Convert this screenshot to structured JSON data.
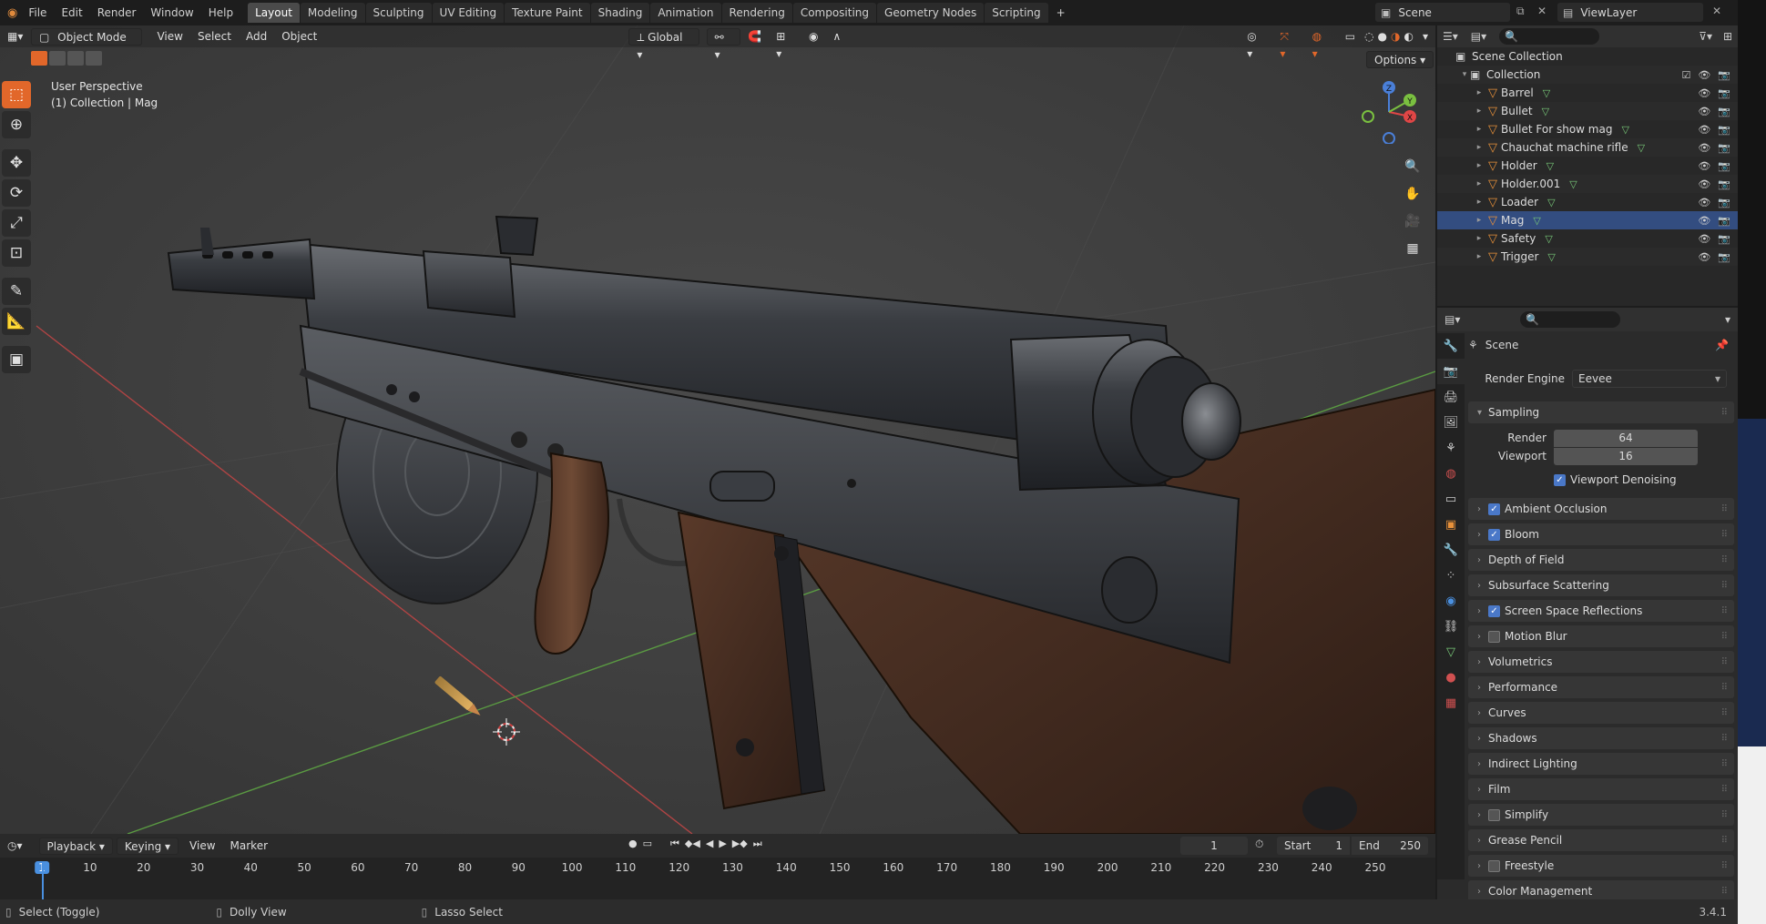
{
  "menus": [
    "File",
    "Edit",
    "Render",
    "Window",
    "Help"
  ],
  "workspaces": [
    "Layout",
    "Modeling",
    "Sculpting",
    "UV Editing",
    "Texture Paint",
    "Shading",
    "Animation",
    "Rendering",
    "Compositing",
    "Geometry Nodes",
    "Scripting",
    "+"
  ],
  "active_workspace": "Layout",
  "scene_name": "Scene",
  "view_layer": "ViewLayer",
  "viewport": {
    "mode": "Object Mode",
    "menu": [
      "View",
      "Select",
      "Add",
      "Object"
    ],
    "orientation": "Global",
    "options_label": "Options",
    "info_line1": "User Perspective",
    "info_line2": "(1) Collection | Mag",
    "gizmo_axes": [
      "X",
      "Y",
      "Z"
    ]
  },
  "outliner": {
    "root": "Scene Collection",
    "collection": "Collection",
    "objects": [
      "Barrel",
      "Bullet",
      "Bullet For show mag",
      "Chauchat  machine rifle",
      "Holder",
      "Holder.001",
      "Loader",
      "Mag",
      "Safety",
      "Trigger"
    ],
    "selected": "Mag"
  },
  "properties": {
    "context": "Scene",
    "render_engine_label": "Render Engine",
    "render_engine": "Eevee",
    "sampling": {
      "title": "Sampling",
      "render_label": "Render",
      "render_value": "64",
      "viewport_label": "Viewport",
      "viewport_value": "16",
      "denoise_label": "Viewport Denoising"
    },
    "panels": [
      {
        "label": "Ambient Occlusion",
        "checkbox": true,
        "checked": true
      },
      {
        "label": "Bloom",
        "checkbox": true,
        "checked": true
      },
      {
        "label": "Depth of Field",
        "checkbox": false
      },
      {
        "label": "Subsurface Scattering",
        "checkbox": false
      },
      {
        "label": "Screen Space Reflections",
        "checkbox": true,
        "checked": true
      },
      {
        "label": "Motion Blur",
        "checkbox": true,
        "checked": false
      },
      {
        "label": "Volumetrics",
        "checkbox": false
      },
      {
        "label": "Performance",
        "checkbox": false
      },
      {
        "label": "Curves",
        "checkbox": false
      },
      {
        "label": "Shadows",
        "checkbox": false
      },
      {
        "label": "Indirect Lighting",
        "checkbox": false
      },
      {
        "label": "Film",
        "checkbox": false
      },
      {
        "label": "Simplify",
        "checkbox": true,
        "checked": false
      },
      {
        "label": "Grease Pencil",
        "checkbox": false
      },
      {
        "label": "Freestyle",
        "checkbox": true,
        "checked": false
      },
      {
        "label": "Color Management",
        "checkbox": false
      }
    ]
  },
  "timeline": {
    "menus": [
      "Playback",
      "Keying",
      "View",
      "Marker"
    ],
    "current_frame": "1",
    "start_label": "Start",
    "start": "1",
    "end_label": "End",
    "end": "250",
    "ticks": [
      "1",
      "10",
      "20",
      "30",
      "40",
      "50",
      "60",
      "70",
      "80",
      "90",
      "100",
      "110",
      "120",
      "130",
      "140",
      "150",
      "160",
      "170",
      "180",
      "190",
      "200",
      "210",
      "220",
      "230",
      "240",
      "250"
    ]
  },
  "statusbar": {
    "select": "Select (Toggle)",
    "dolly": "Dolly View",
    "lasso": "Lasso Select",
    "version": "3.4.1"
  },
  "colors": {
    "accent": "#e2672a",
    "selection": "#334d80",
    "checkbox": "#4a78c8",
    "object_icon": "#e8913a",
    "mesh_icon": "#78c878"
  }
}
